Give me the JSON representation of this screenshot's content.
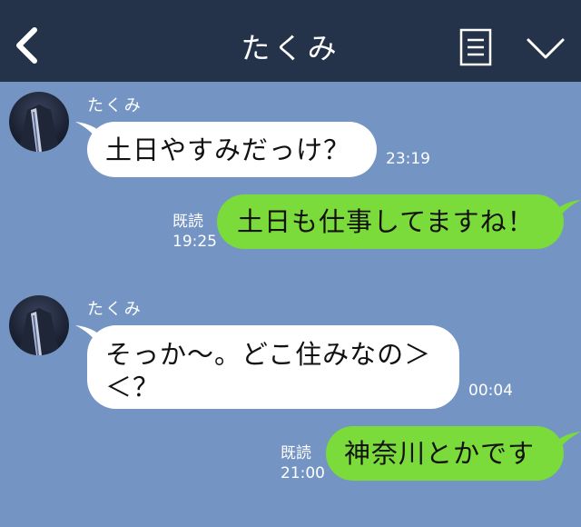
{
  "header": {
    "title": "たくみ",
    "back_icon": "chevron-left-icon",
    "note_icon": "note-icon",
    "menu_icon": "chevron-down-icon",
    "background": "#243349"
  },
  "colors": {
    "chat_background": "#7494c4",
    "incoming_bubble": "#ffffff",
    "outgoing_bubble": "#7bdb3a"
  },
  "messages": [
    {
      "direction": "incoming",
      "sender": "たくみ",
      "text": "土日やすみだっけ？",
      "time": "23:19"
    },
    {
      "direction": "outgoing",
      "read": "既読",
      "text": "土日も仕事してますね！",
      "time": "19:25"
    },
    {
      "direction": "incoming",
      "sender": "たくみ",
      "text_line1": "そっか〜。どこ住みなの＞",
      "text_line2": "＜？",
      "time": "00:04"
    },
    {
      "direction": "outgoing",
      "read": "既読",
      "text": "神奈川とかです",
      "time": "21:00"
    }
  ]
}
